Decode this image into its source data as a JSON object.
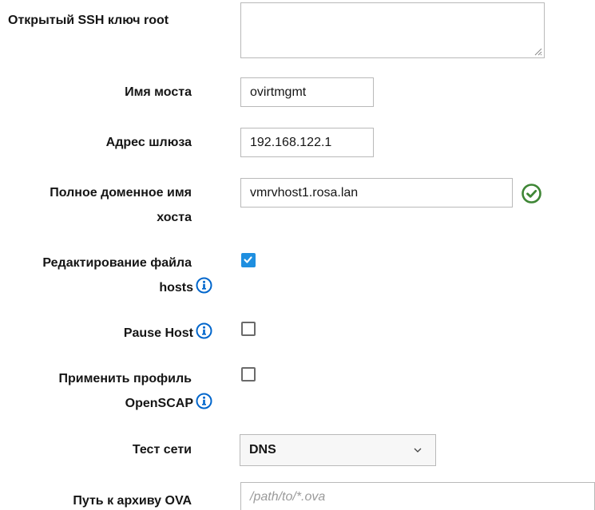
{
  "fields": {
    "ssh_key": {
      "label": "Открытый SSH ключ root",
      "value": ""
    },
    "bridge_name": {
      "label": "Имя моста",
      "value": "ovirtmgmt"
    },
    "gateway": {
      "label": "Адрес шлюза",
      "value": "192.168.122.1"
    },
    "fqdn": {
      "label_line1": "Полное доменное имя",
      "label_line2": "хоста",
      "value": "vmrvhost1.rosa.lan",
      "validation": "valid"
    },
    "edit_hosts": {
      "label_line1": "Редактирование файла",
      "label_line2": "hosts",
      "checked": true
    },
    "pause_host": {
      "label": "Pause Host",
      "checked": false
    },
    "openscap": {
      "label_line1": "Применить профиль",
      "label_line2": "OpenSCAP",
      "checked": false
    },
    "network_test": {
      "label": "Тест сети",
      "selected": "DNS"
    },
    "ova_path": {
      "label": "Путь к архиву OVA",
      "placeholder": "/path/to/*.ova",
      "value": ""
    }
  },
  "colors": {
    "accent": "#1f8fe0",
    "valid": "#3e8635",
    "info": "#0066cc",
    "border": "#b9b9b9"
  },
  "icons": {
    "info": "info-circle-icon",
    "valid": "check-circle-icon",
    "dropdown": "chevron-down-icon"
  }
}
